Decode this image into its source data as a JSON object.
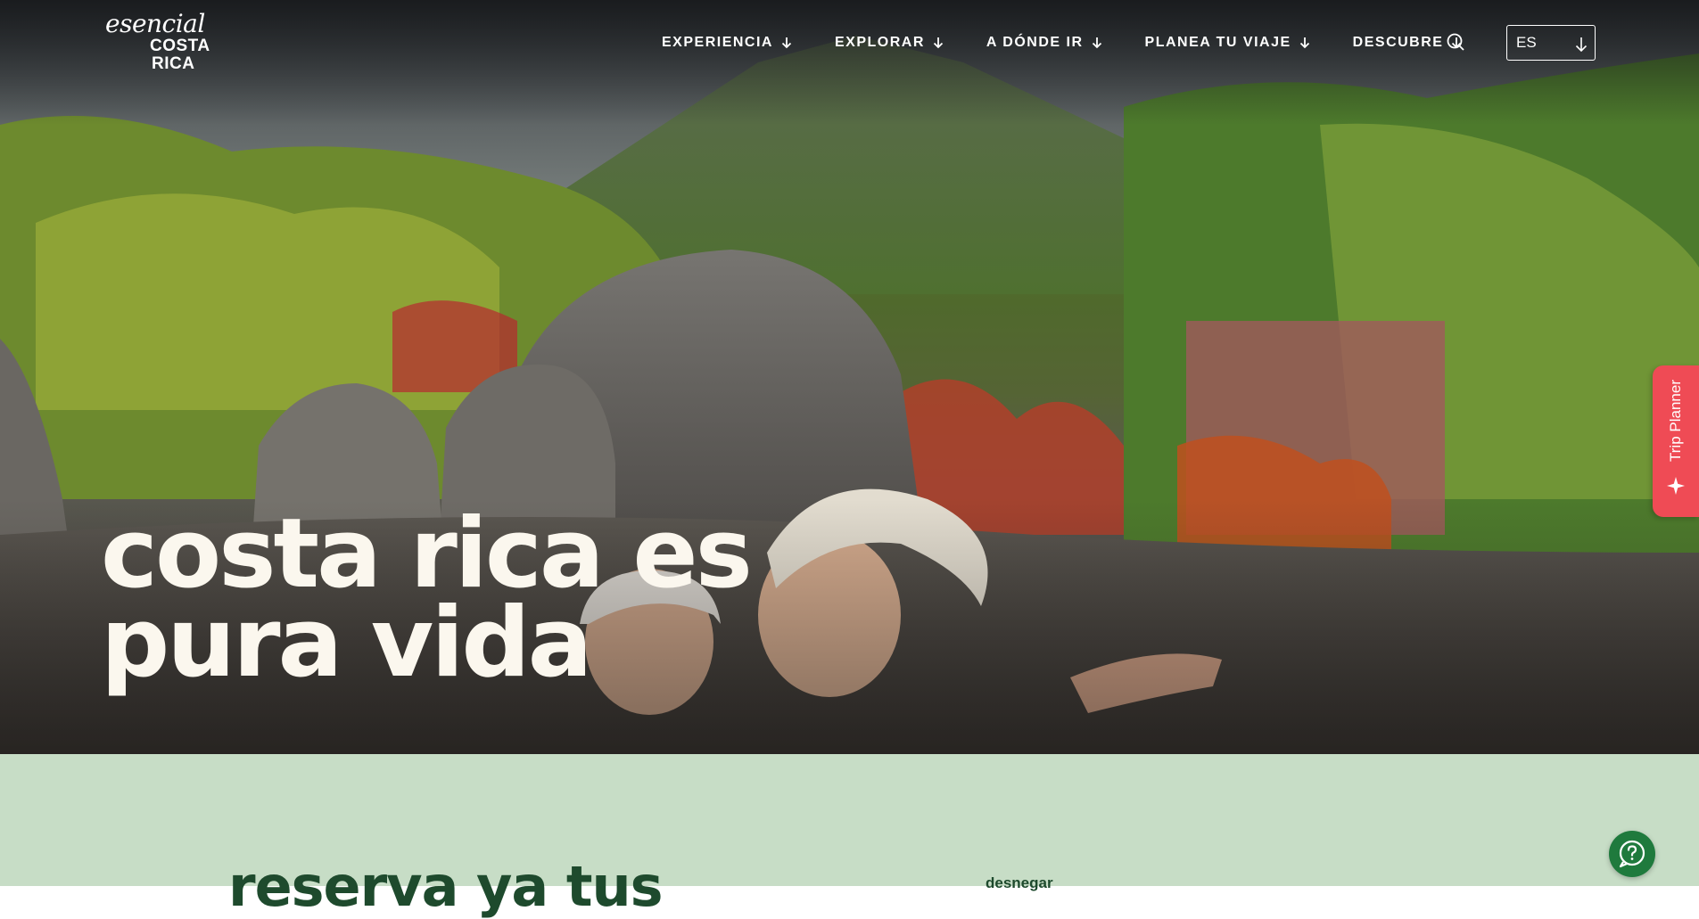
{
  "brand": {
    "logo_script": "esencial",
    "logo_line1": "COSTA",
    "logo_line2": "RICA"
  },
  "nav": {
    "items": [
      {
        "label": "EXPERIENCIA",
        "icon": "arrow-down-icon"
      },
      {
        "label": "EXPLORAR",
        "icon": "arrow-down-icon"
      },
      {
        "label": "A DÓNDE IR",
        "icon": "arrow-down-icon"
      },
      {
        "label": "PLANEA TU VIAJE",
        "icon": "arrow-down-icon"
      },
      {
        "label": "DESCUBRE",
        "icon": "arrow-down-icon"
      }
    ],
    "search_icon": "search-icon",
    "language": {
      "selected": "ES",
      "icon": "arrow-down-icon"
    }
  },
  "hero": {
    "headline": "costa rica es pura vida",
    "image_description_icon": "hero-photo"
  },
  "trip_planner": {
    "label": "Trip Planner",
    "icon": "sparkle-icon"
  },
  "band": {
    "title": "reserva ya tus",
    "link": "desnegar"
  },
  "help": {
    "icon": "help-chat-icon"
  },
  "colors": {
    "text_on_hero": "#fbf7ee",
    "trip_planner_bg": "#ef4b55",
    "band_bg": "#c7ddc6",
    "band_text": "#1e4a2d",
    "help_button_bg": "#1f7a3d"
  }
}
